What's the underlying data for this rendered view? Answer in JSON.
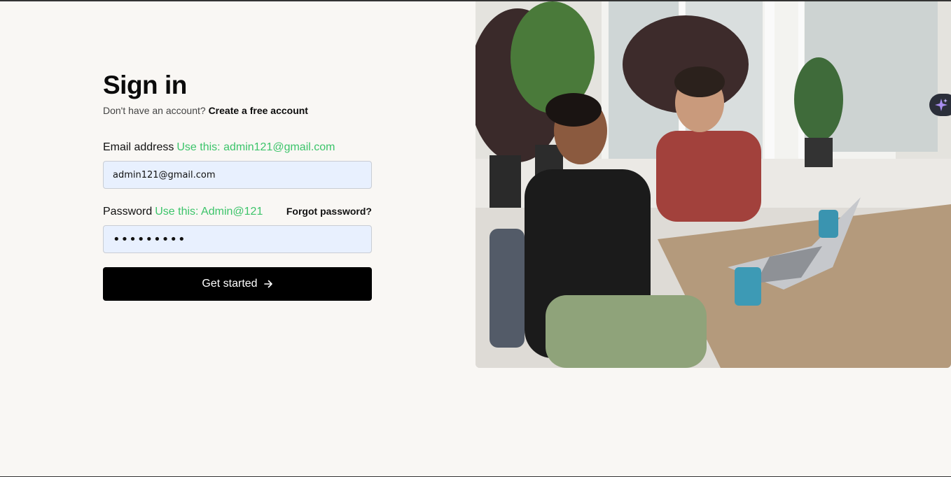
{
  "signin": {
    "title": "Sign in",
    "no_account": "Don't have an account?",
    "create_link": "Create a free account",
    "email_label": "Email address",
    "email_hint": "Use this: admin121@gmail.com",
    "email_value": "admin121@gmail.com",
    "password_label": "Password",
    "password_hint": "Use this: Admin@121",
    "password_value": "Admin@121",
    "forgot": "Forgot password?",
    "submit": "Get started"
  },
  "icons": {
    "submit_arrow": "arrow-right-icon",
    "assistant": "sparkle-icon"
  },
  "colors": {
    "hint": "#3cc46a",
    "button": "#000000",
    "input_bg": "#e8f0fe",
    "page_bg": "#f9f7f4"
  }
}
